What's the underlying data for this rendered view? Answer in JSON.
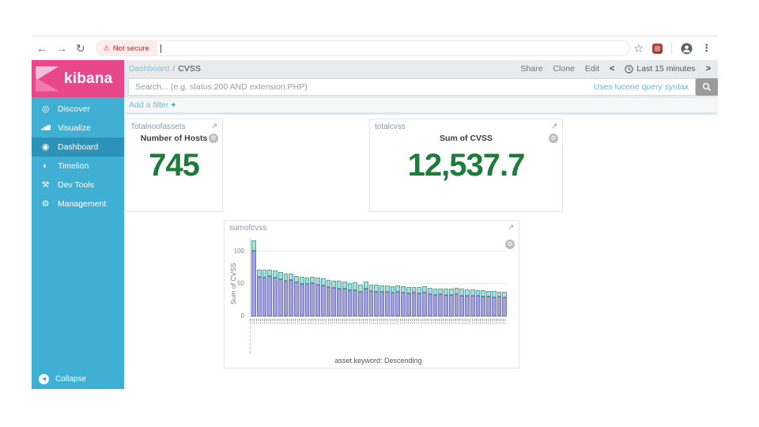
{
  "browser": {
    "security_label": "Not secure",
    "icons": {
      "back": "←",
      "forward": "→",
      "reload": "↻",
      "bookmark": "☆",
      "menu": "⋮",
      "warning": "⚠"
    }
  },
  "sidebar": {
    "logo_text": "kibana",
    "items": [
      {
        "label": "Discover",
        "icon": "◎"
      },
      {
        "label": "Visualize",
        "icon": "▂▅▇"
      },
      {
        "label": "Dashboard",
        "icon": "◉"
      },
      {
        "label": "Timelion",
        "icon": "◐"
      },
      {
        "label": "Dev Tools",
        "icon": "⚒"
      },
      {
        "label": "Management",
        "icon": "⚙"
      }
    ],
    "collapse_label": "Collapse",
    "collapse_icon": "◀"
  },
  "topnav": {
    "breadcrumb": {
      "root": "Dashboard",
      "separator": "/",
      "current": "CVSS"
    },
    "actions": {
      "share": "Share",
      "clone": "Clone",
      "edit": "Edit"
    },
    "time_picker": {
      "label": "Last 15 minutes",
      "prev": "<",
      "next": ">"
    }
  },
  "query_bar": {
    "placeholder": "Search... (e.g. status:200 AND extension:PHP)",
    "syntax_hint": "Uses lucene query syntax"
  },
  "filter_bar": {
    "add_filter_label": "Add a filter",
    "plus": "+"
  },
  "panels": {
    "metric1": {
      "title": "Totalnoofassets",
      "label": "Number of Hosts",
      "value": "745",
      "expand_icon": "↗",
      "gear_icon": "⚙"
    },
    "metric2": {
      "title": "totalcvss",
      "label": "Sum of CVSS",
      "value": "12,537.7",
      "expand_icon": "↗",
      "gear_icon": "⚙"
    },
    "chart": {
      "title": "sumofcvss",
      "expand_icon": "↗",
      "gear_icon": "⚙"
    }
  },
  "chart_data": {
    "type": "bar",
    "stacked": true,
    "title": "sumofcvss",
    "xlabel": "asset.keyword: Descending",
    "ylabel": "Sum of CVSS",
    "ylim": [
      0,
      120
    ],
    "yticks": [
      0,
      50,
      100
    ],
    "grid": true,
    "legend": false,
    "xtick_labels_illegible": true,
    "series": [
      {
        "name": "bottom-segment",
        "color": "#a2a2dc",
        "border": "#7272bd",
        "values": [
          101,
          61,
          60,
          62,
          60,
          57,
          55,
          56,
          52,
          50,
          50,
          51,
          48,
          47,
          45,
          44,
          42,
          43,
          40,
          40,
          38,
          42,
          39,
          38,
          37,
          37,
          36,
          38,
          36,
          35,
          36,
          35,
          36,
          34,
          33,
          34,
          33,
          33,
          34,
          32,
          31,
          32,
          31,
          30,
          30,
          29,
          30,
          29
        ]
      },
      {
        "name": "top-segment",
        "color": "#abdcd8",
        "border": "#58a8a2",
        "values": [
          16,
          11,
          11,
          9,
          10,
          11,
          11,
          9,
          10,
          11,
          10,
          10,
          12,
          11,
          11,
          10,
          12,
          10,
          11,
          12,
          11,
          11,
          10,
          11,
          10,
          10,
          10,
          9,
          10,
          10,
          9,
          10,
          10,
          10,
          10,
          9,
          10,
          9,
          10,
          10,
          10,
          9,
          9,
          10,
          9,
          10,
          8,
          9
        ]
      }
    ]
  },
  "colors": {
    "accent_pink": "#e8478b",
    "sidebar_blue": "#3fb0d4",
    "sidebar_active": "#2e93b9",
    "metric_green": "#1c7c39",
    "link_teal": "#7cbccb",
    "breadcrumb_link": "#82c8dc",
    "bar_purple": "#a2a2dc",
    "bar_teal": "#abdcd8",
    "not_secure_red": "#c5221f"
  }
}
